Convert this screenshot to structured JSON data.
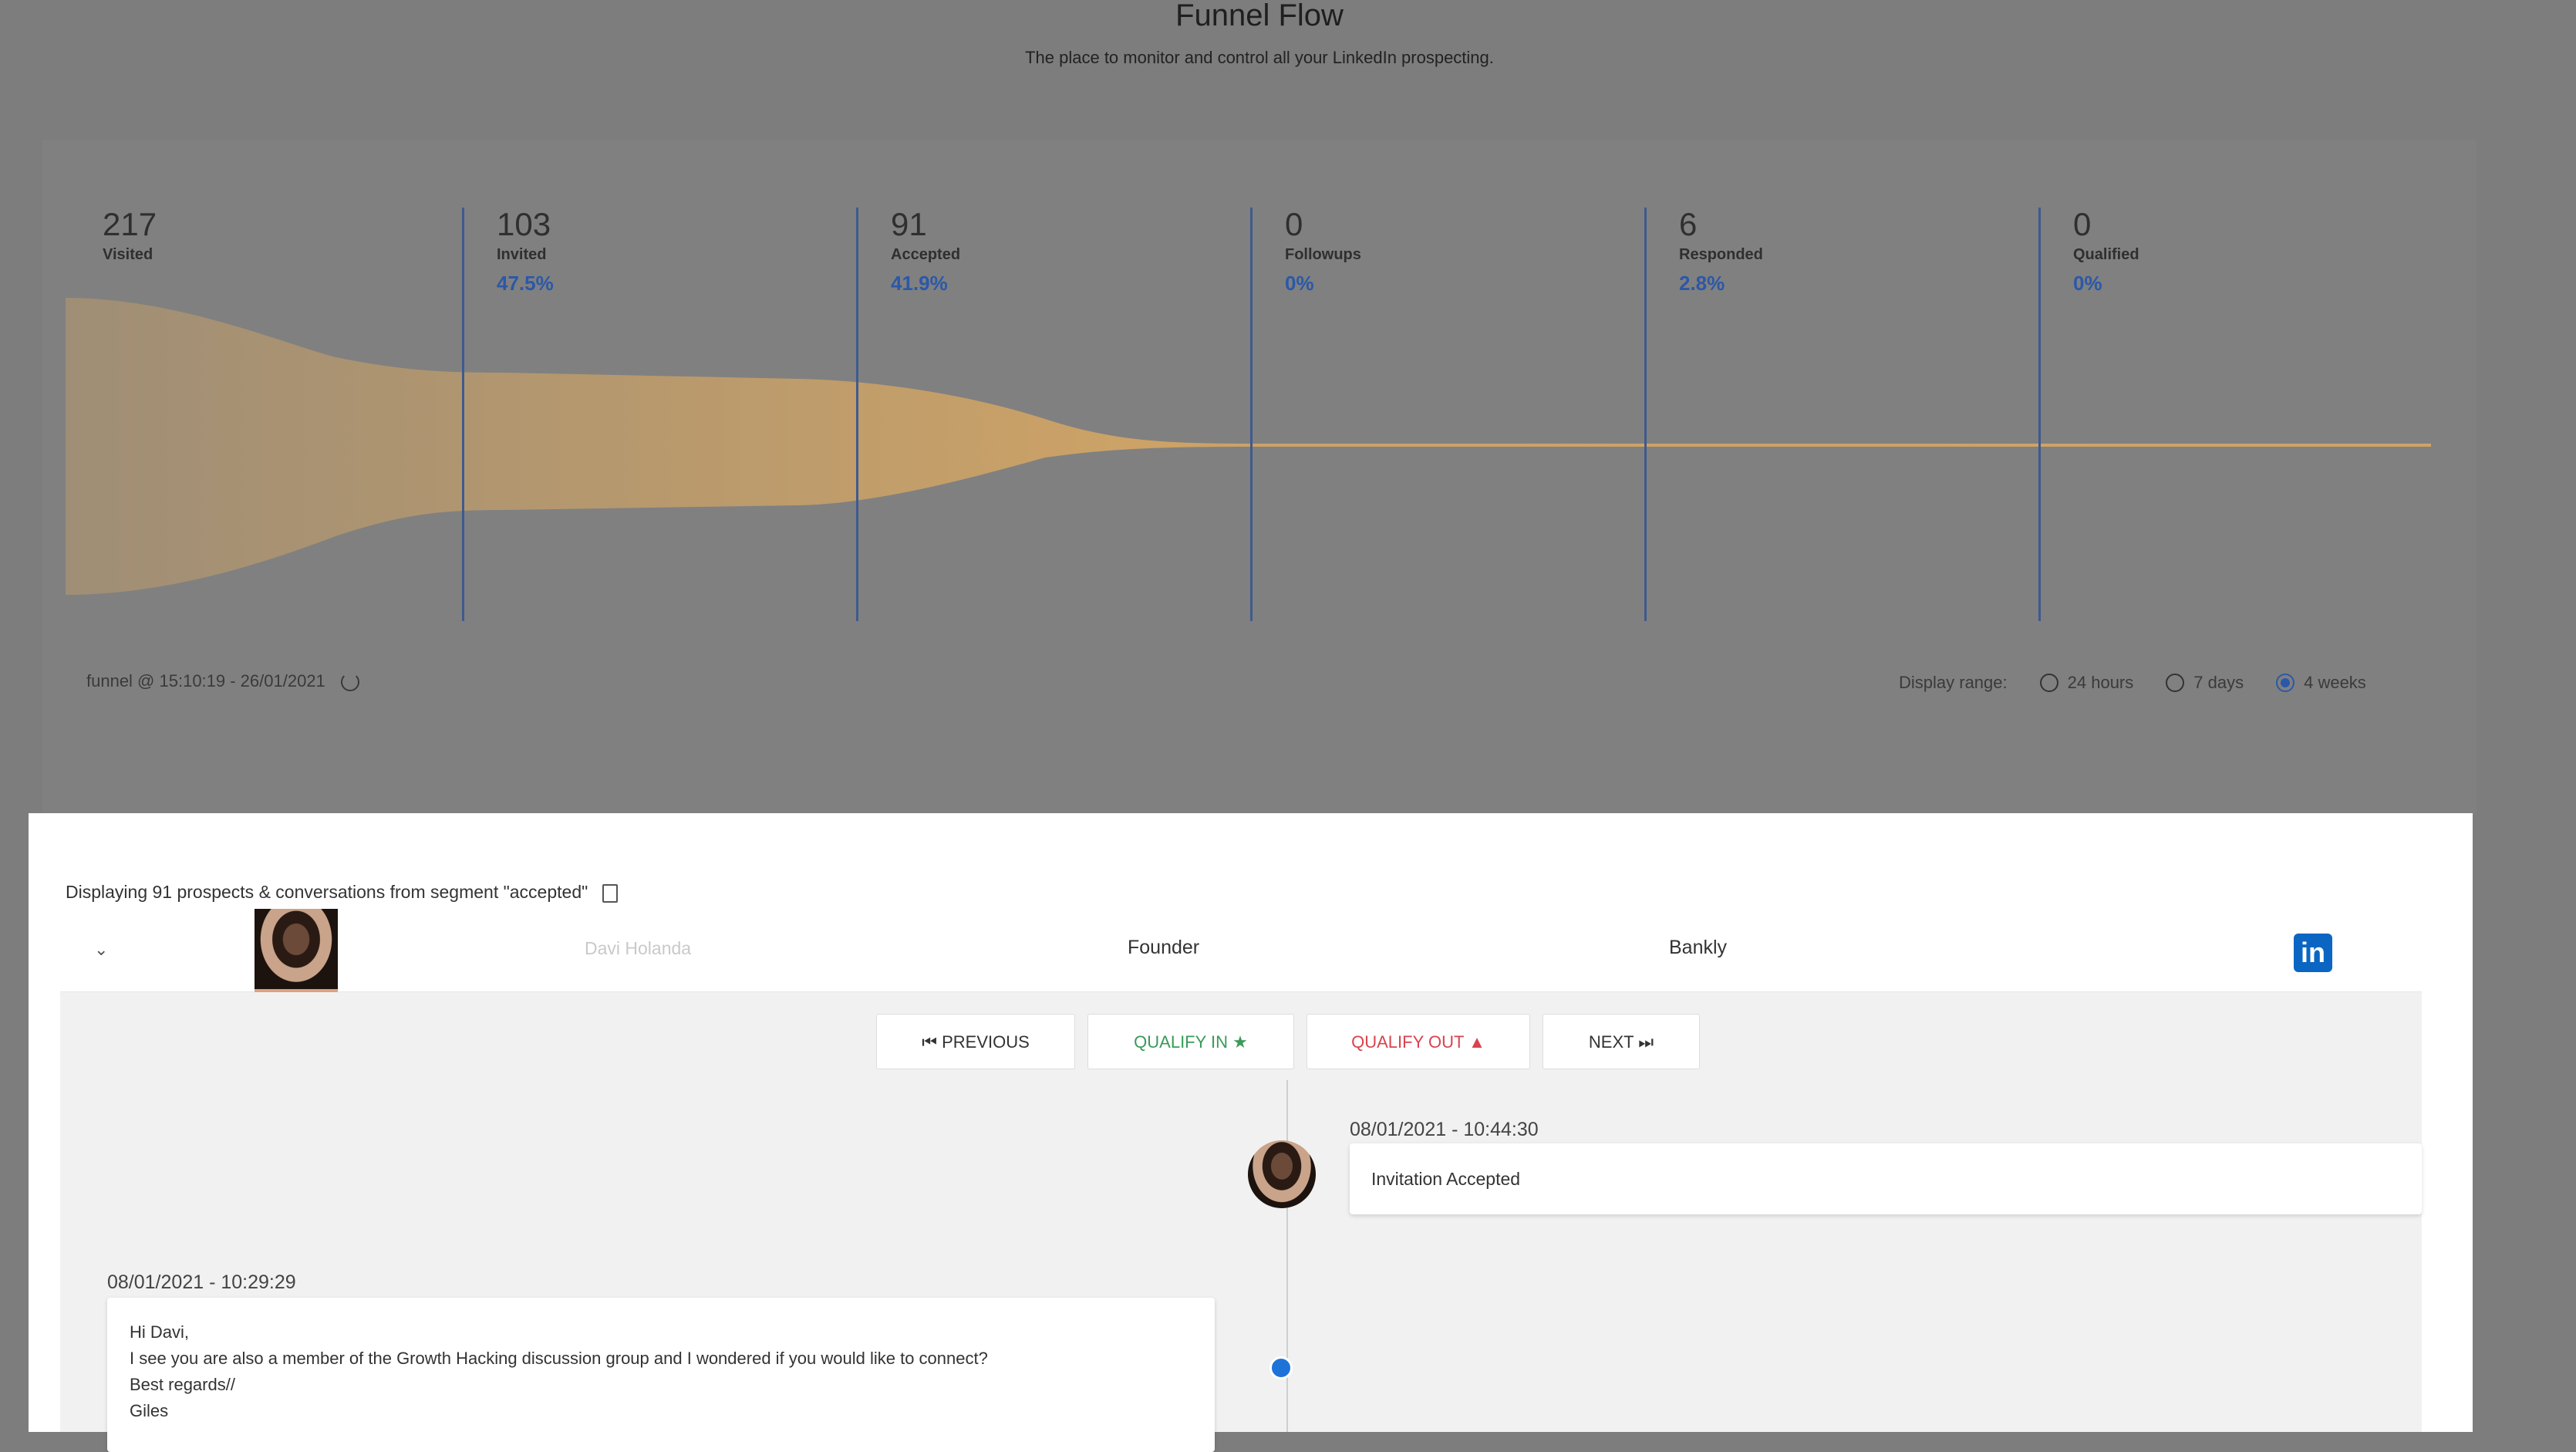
{
  "header": {
    "title": "Funnel Flow",
    "subtitle": "The place to monitor and control all your LinkedIn prospecting."
  },
  "funnel": {
    "stages": [
      {
        "count": "217",
        "name": "Visited",
        "pct": ""
      },
      {
        "count": "103",
        "name": "Invited",
        "pct": "47.5%"
      },
      {
        "count": "91",
        "name": "Accepted",
        "pct": "41.9%"
      },
      {
        "count": "0",
        "name": "Followups",
        "pct": "0%"
      },
      {
        "count": "6",
        "name": "Responded",
        "pct": "2.8%"
      },
      {
        "count": "0",
        "name": "Qualified",
        "pct": "0%"
      }
    ],
    "footer_label": "funnel @ 15:10:19 - 26/01/2021",
    "range_label": "Display range:",
    "range_options": [
      "24 hours",
      "7 days",
      "4 weeks"
    ],
    "range_selected": "4 weeks",
    "colors": {
      "flow": "#d9a862",
      "divider": "#3f5a8e",
      "percent": "#2b58a8"
    }
  },
  "prospects": {
    "display_text": "Displaying 91 prospects & conversations from segment \"accepted\"",
    "row": {
      "name": "Davi Holanda",
      "title": "Founder",
      "company": "Bankly",
      "linkedin_icon": "linkedin-icon"
    },
    "buttons": {
      "previous": "⏮ PREVIOUS",
      "qualify_in": "QUALIFY IN ★",
      "qualify_out": "QUALIFY OUT ▲",
      "next": "NEXT ⏭"
    }
  },
  "conversation": {
    "messages": [
      {
        "time": "08/01/2021 - 10:44:30",
        "text": "Invitation Accepted"
      },
      {
        "time": "08/01/2021 - 10:29:29",
        "lines": [
          "Hi Davi,",
          "I see you are also a member of the Growth Hacking discussion group and I wondered if you would like to connect?",
          "Best regards//",
          "Giles"
        ]
      }
    ]
  }
}
